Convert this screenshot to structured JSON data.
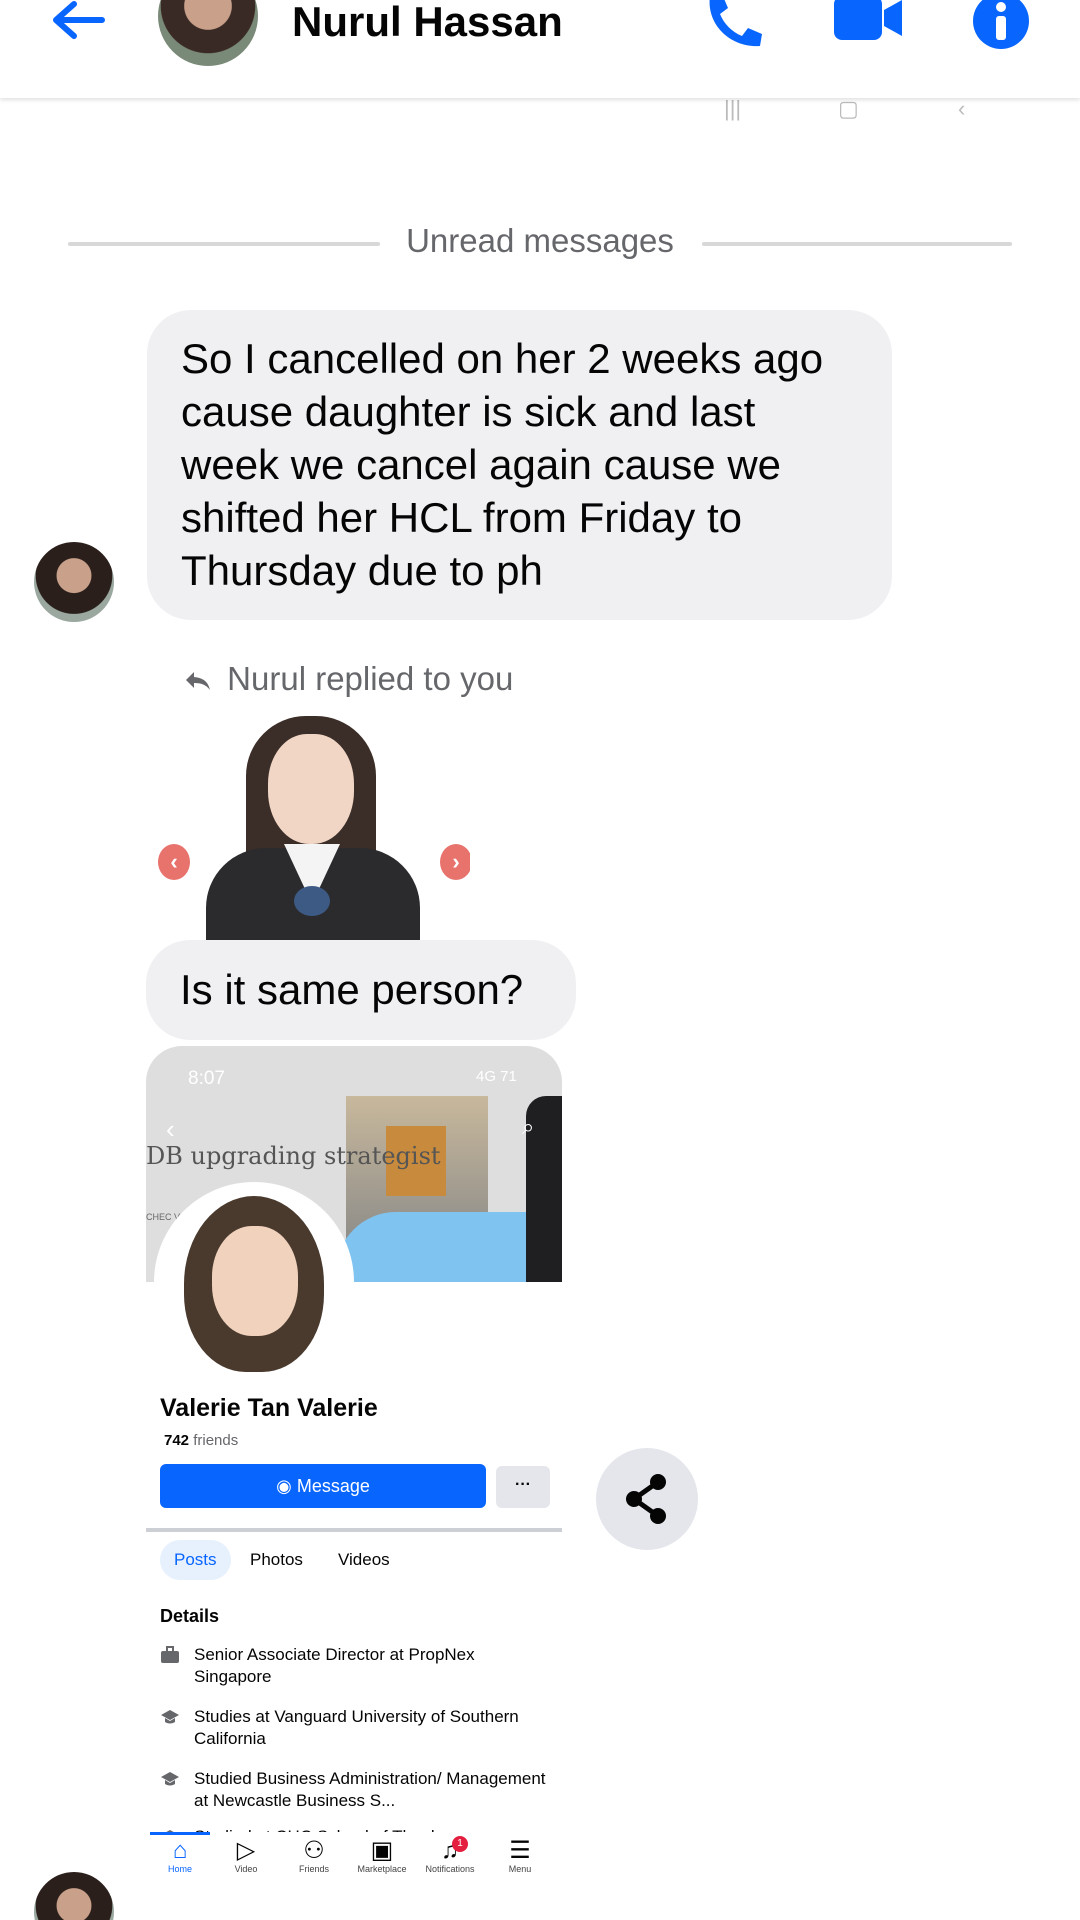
{
  "header": {
    "contact_name": "Nurul Hassan"
  },
  "icons": {
    "back": "arrow-left-icon",
    "call": "phone-icon",
    "video": "video-camera-icon",
    "info": "info-icon",
    "share": "share-icon"
  },
  "colors": {
    "accent": "#0866ff",
    "bubble": "#f0f0f3",
    "secondary_text": "#65676b"
  },
  "divider": {
    "label": "Unread messages"
  },
  "messages": [
    {
      "text": "So I cancelled on her 2 weeks ago cause daughter is sick and last week we cancel again cause we shifted her HCL from Friday to Thursday due to ph"
    },
    {
      "reply_label": "Nurul replied to you"
    },
    {
      "text": "Is it same person?"
    }
  ],
  "shared_screenshot": {
    "time": "8:07",
    "status": "4G 71",
    "cover_text": "DB upgrading strategist",
    "cover_small": "CHEC VID",
    "profile_name": "Valerie Tan Valerie",
    "friends_count": "742",
    "friends_label": "friends",
    "message_button": "Message",
    "more_button": "···",
    "tabs": [
      "Posts",
      "Photos",
      "Videos"
    ],
    "details_title": "Details",
    "details": [
      "Senior Associate Director at PropNex Singapore",
      "Studies at Vanguard University of Southern California",
      "Studied Business Administration/ Management at Newcastle Business S...",
      "Studied at CHC School of Theology"
    ],
    "nav": [
      {
        "label": "Home"
      },
      {
        "label": "Video"
      },
      {
        "label": "Friends"
      },
      {
        "label": "Marketplace"
      },
      {
        "label": "Notifications",
        "badge": "1"
      },
      {
        "label": "Menu"
      }
    ]
  }
}
